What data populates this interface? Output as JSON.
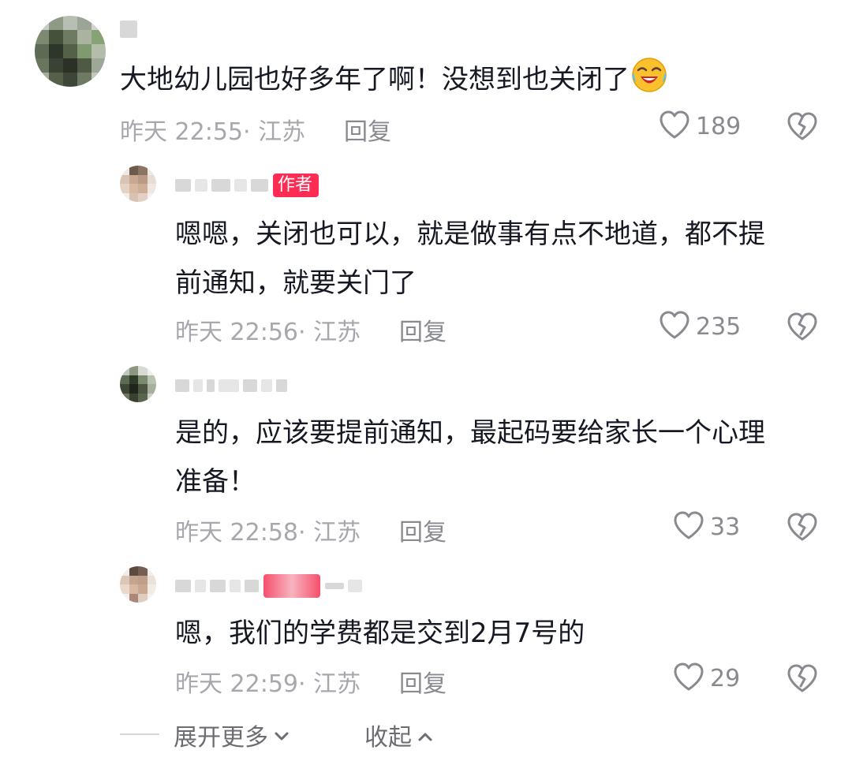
{
  "comments": [
    {
      "text": "大地幼儿园也好多年了啊！没想到也关闭了",
      "emoji": "laughing-crying-emoji",
      "time_location": "昨天 22:55· 江苏",
      "reply_label": "回复",
      "likes": "189"
    },
    {
      "badge": "作者",
      "text_line1": "嗯嗯，关闭也可以，就是做事有点不地道，都不提",
      "text_line2": "前通知，就要关门了",
      "time_location": "昨天 22:56· 江苏",
      "reply_label": "回复",
      "likes": "235"
    },
    {
      "text_line1": "是的，应该要提前通知，最起码要给家长一个心理",
      "text_line2": "准备！",
      "time_location": "昨天 22:58· 江苏",
      "reply_label": "回复",
      "likes": "33"
    },
    {
      "text_line1": "嗯，我们的学费都是交到2月7号的",
      "time_location": "昨天 22:59· 江苏",
      "reply_label": "回复",
      "likes": "29"
    }
  ],
  "footer": {
    "expand_label": "展开更多",
    "collapse_label": "收起"
  },
  "icons": {
    "like": "heart-outline-icon",
    "dislike": "broken-heart-icon",
    "expand": "chevron-down-icon",
    "collapse": "chevron-up-icon"
  },
  "colors": {
    "text": "#161823",
    "meta": "#a7a8ad",
    "action": "#898a90",
    "author_badge": "#fe2c55"
  }
}
